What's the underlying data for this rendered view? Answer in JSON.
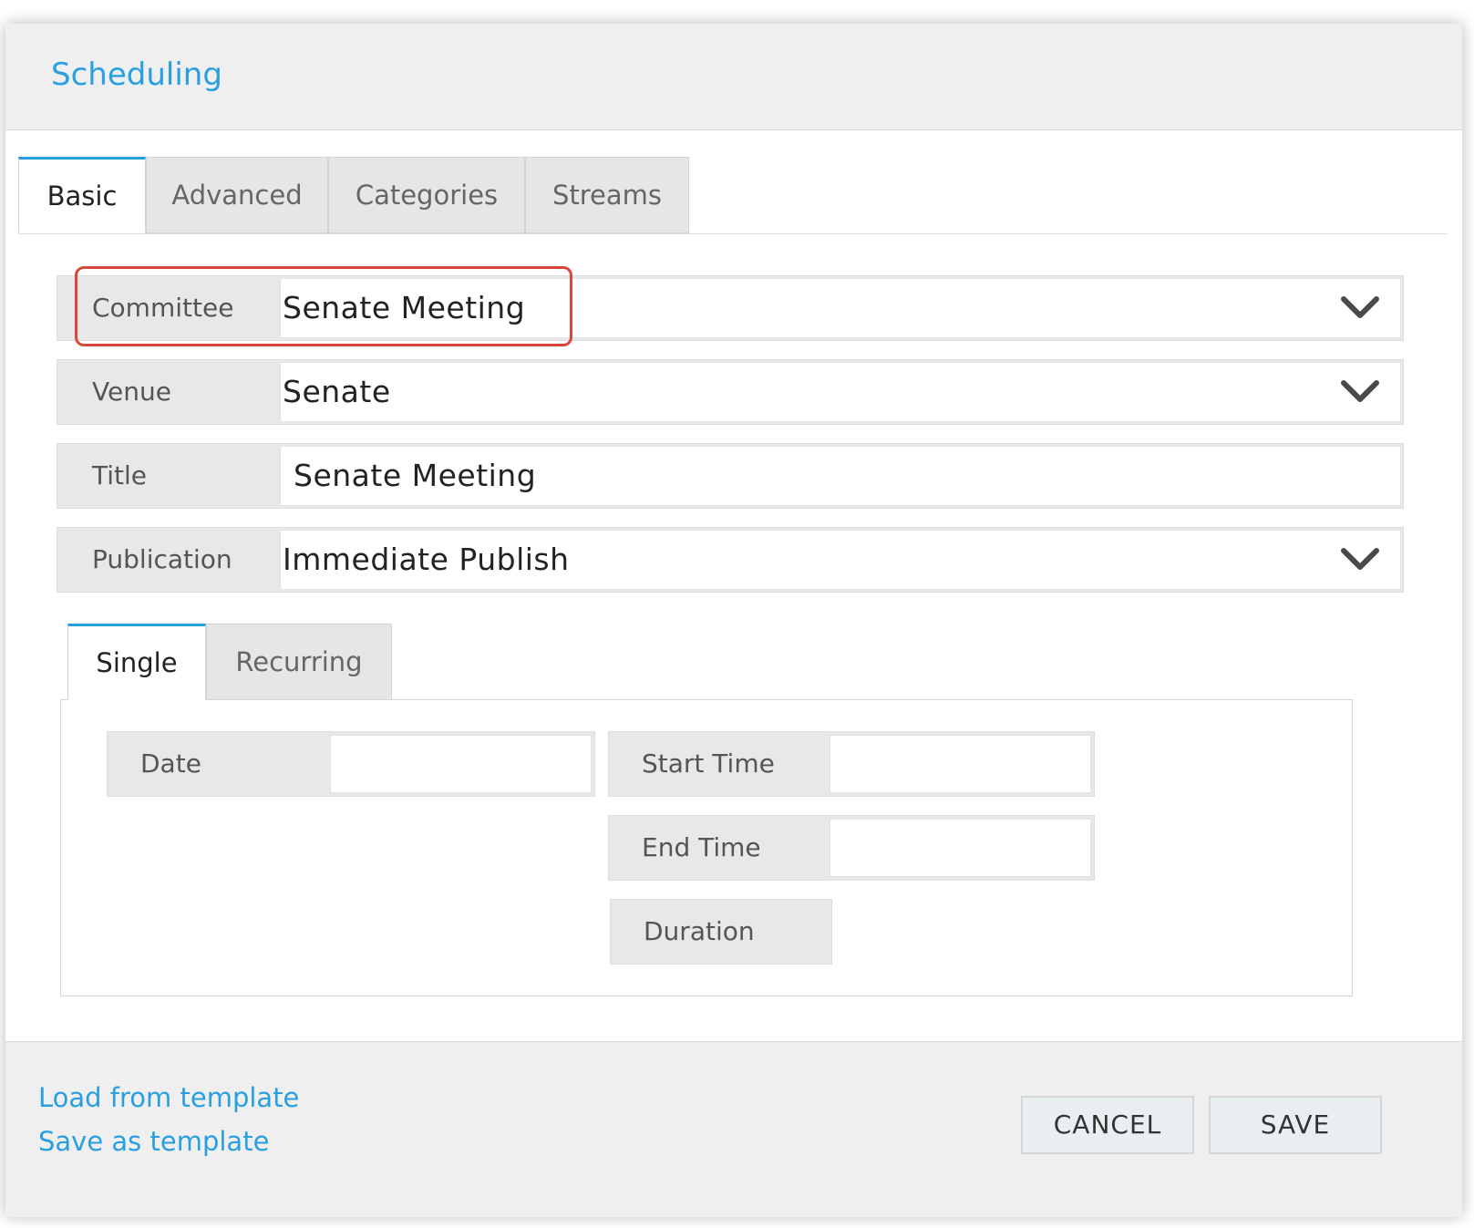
{
  "dialog": {
    "title": "Scheduling"
  },
  "tabs": [
    "Basic",
    "Advanced",
    "Categories",
    "Streams"
  ],
  "form": {
    "committee": {
      "label": "Committee",
      "value": "Senate Meeting"
    },
    "venue": {
      "label": "Venue",
      "value": "Senate"
    },
    "title": {
      "label": "Title",
      "value": "Senate Meeting"
    },
    "publication": {
      "label": "Publication",
      "value": "Immediate Publish"
    }
  },
  "schedule_tabs": [
    "Single",
    "Recurring"
  ],
  "single": {
    "date_label": "Date",
    "start_time_label": "Start Time",
    "end_time_label": "End Time",
    "duration_label": "Duration"
  },
  "footer": {
    "load_template": "Load from template",
    "save_template": "Save as template",
    "cancel": "CANCEL",
    "save": "SAVE"
  },
  "colors": {
    "accent": "#2a9fe0",
    "highlight": "#d9483b"
  }
}
